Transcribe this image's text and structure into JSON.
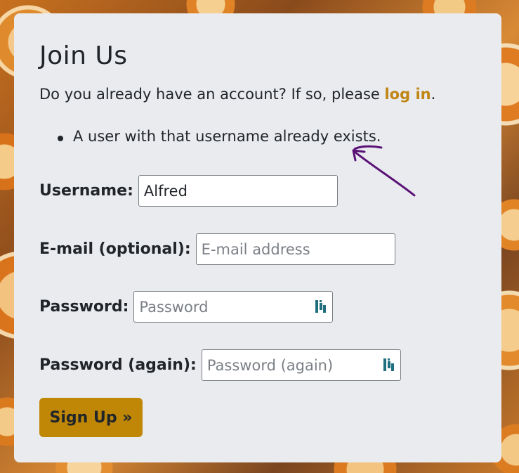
{
  "form": {
    "title": "Join Us",
    "intro_text": "Do you already have an account? If so, please ",
    "login_link": "log in",
    "intro_end": ".",
    "errors": [
      "A user with that username already exists."
    ],
    "username": {
      "label": "Username:",
      "value": "Alfred",
      "placeholder": ""
    },
    "email": {
      "label": "E-mail (optional):",
      "value": "",
      "placeholder": "E-mail address"
    },
    "password": {
      "label": "Password:",
      "value": "",
      "placeholder": "Password",
      "icon": "password-manager-icon"
    },
    "password_again": {
      "label": "Password (again):",
      "value": "",
      "placeholder": "Password (again)",
      "icon": "password-manager-icon"
    },
    "submit_label": "Sign Up »"
  },
  "colors": {
    "accent": "#c08707",
    "link": "#c08514",
    "card_bg": "#e9ebef",
    "annotation": "#5a1276",
    "pw_icon": "#1f6f7e"
  }
}
